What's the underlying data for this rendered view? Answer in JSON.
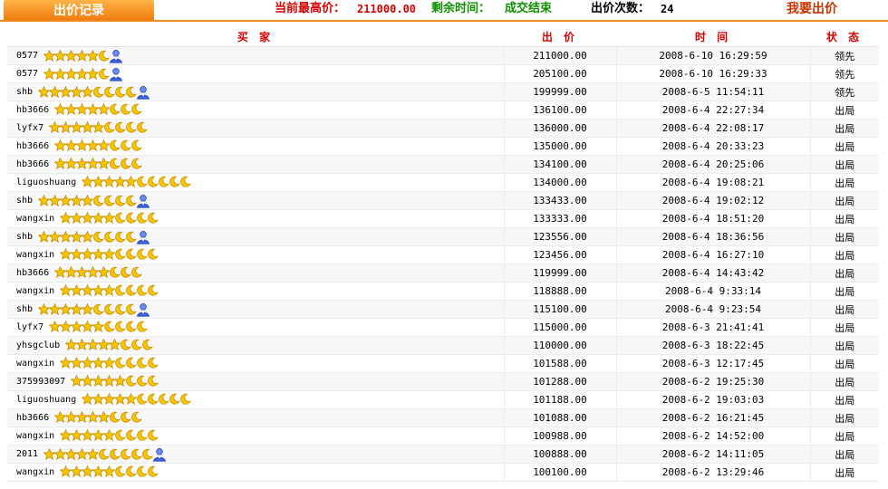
{
  "header": {
    "tab_label": "出价记录",
    "highest_price_label": "当前最高价：",
    "highest_price_value": "211000.00",
    "remaining_time_label": "剩余时间：",
    "remaining_time_value": "成交结束",
    "bid_count_label": "出价次数：",
    "bid_count_value": "24",
    "bid_button_label": "我要出价"
  },
  "table": {
    "columns": [
      "买 家",
      "出 价",
      "时 间",
      "状 态"
    ],
    "rows": [
      {
        "buyer": "0577",
        "stars": 5,
        "moons": 1,
        "vip": true,
        "price": "211000.00",
        "time": "2008-6-10 16:29:59",
        "status": "领先"
      },
      {
        "buyer": "0577",
        "stars": 5,
        "moons": 1,
        "vip": true,
        "price": "205100.00",
        "time": "2008-6-10 16:29:33",
        "status": "领先"
      },
      {
        "buyer": "shb",
        "stars": 5,
        "moons": 4,
        "vip": true,
        "price": "199999.00",
        "time": "2008-6-5 11:54:11",
        "status": "领先"
      },
      {
        "buyer": "hb3666",
        "stars": 5,
        "moons": 3,
        "vip": false,
        "price": "136100.00",
        "time": "2008-6-4 22:27:34",
        "status": "出局"
      },
      {
        "buyer": "lyfx7",
        "stars": 5,
        "moons": 4,
        "vip": false,
        "price": "136000.00",
        "time": "2008-6-4 22:08:17",
        "status": "出局"
      },
      {
        "buyer": "hb3666",
        "stars": 5,
        "moons": 3,
        "vip": false,
        "price": "135000.00",
        "time": "2008-6-4 20:33:23",
        "status": "出局"
      },
      {
        "buyer": "hb3666",
        "stars": 5,
        "moons": 3,
        "vip": false,
        "price": "134100.00",
        "time": "2008-6-4 20:25:06",
        "status": "出局"
      },
      {
        "buyer": "liguoshuang",
        "stars": 5,
        "moons": 5,
        "vip": false,
        "price": "134000.00",
        "time": "2008-6-4 19:08:21",
        "status": "出局"
      },
      {
        "buyer": "shb",
        "stars": 5,
        "moons": 4,
        "vip": true,
        "price": "133433.00",
        "time": "2008-6-4 19:02:12",
        "status": "出局"
      },
      {
        "buyer": "wangxin",
        "stars": 5,
        "moons": 4,
        "vip": false,
        "price": "133333.00",
        "time": "2008-6-4 18:51:20",
        "status": "出局"
      },
      {
        "buyer": "shb",
        "stars": 5,
        "moons": 4,
        "vip": true,
        "price": "123556.00",
        "time": "2008-6-4 18:36:56",
        "status": "出局"
      },
      {
        "buyer": "wangxin",
        "stars": 5,
        "moons": 4,
        "vip": false,
        "price": "123456.00",
        "time": "2008-6-4 16:27:10",
        "status": "出局"
      },
      {
        "buyer": "hb3666",
        "stars": 5,
        "moons": 3,
        "vip": false,
        "price": "119999.00",
        "time": "2008-6-4 14:43:42",
        "status": "出局"
      },
      {
        "buyer": "wangxin",
        "stars": 5,
        "moons": 4,
        "vip": false,
        "price": "118888.00",
        "time": "2008-6-4 9:33:14",
        "status": "出局"
      },
      {
        "buyer": "shb",
        "stars": 5,
        "moons": 4,
        "vip": true,
        "price": "115100.00",
        "time": "2008-6-4 9:23:54",
        "status": "出局"
      },
      {
        "buyer": "lyfx7",
        "stars": 5,
        "moons": 4,
        "vip": false,
        "price": "115000.00",
        "time": "2008-6-3 21:41:41",
        "status": "出局"
      },
      {
        "buyer": "yhsgclub",
        "stars": 5,
        "moons": 3,
        "vip": false,
        "price": "110000.00",
        "time": "2008-6-3 18:22:45",
        "status": "出局"
      },
      {
        "buyer": "wangxin",
        "stars": 5,
        "moons": 4,
        "vip": false,
        "price": "101588.00",
        "time": "2008-6-3 12:17:45",
        "status": "出局"
      },
      {
        "buyer": "375993097",
        "stars": 5,
        "moons": 3,
        "vip": false,
        "price": "101288.00",
        "time": "2008-6-2 19:25:30",
        "status": "出局"
      },
      {
        "buyer": "liguoshuang",
        "stars": 5,
        "moons": 5,
        "vip": false,
        "price": "101188.00",
        "time": "2008-6-2 19:03:03",
        "status": "出局"
      },
      {
        "buyer": "hb3666",
        "stars": 5,
        "moons": 3,
        "vip": false,
        "price": "101088.00",
        "time": "2008-6-2 16:21:45",
        "status": "出局"
      },
      {
        "buyer": "wangxin",
        "stars": 5,
        "moons": 4,
        "vip": false,
        "price": "100988.00",
        "time": "2008-6-2 14:52:00",
        "status": "出局"
      },
      {
        "buyer": "2011",
        "stars": 5,
        "moons": 5,
        "vip": true,
        "price": "100888.00",
        "time": "2008-6-2 14:11:05",
        "status": "出局"
      },
      {
        "buyer": "wangxin",
        "stars": 5,
        "moons": 4,
        "vip": false,
        "price": "100100.00",
        "time": "2008-6-2 13:29:46",
        "status": "出局"
      }
    ]
  },
  "icons": {
    "star": "star-icon",
    "moon": "moon-icon",
    "vip": "vip-user-icon"
  },
  "colors": {
    "accent_orange": "#f08a1c",
    "price_red": "#d80000",
    "time_green": "#0f8f00",
    "star_gold": "#f7c600",
    "vip_blue": "#3a5fd8"
  }
}
